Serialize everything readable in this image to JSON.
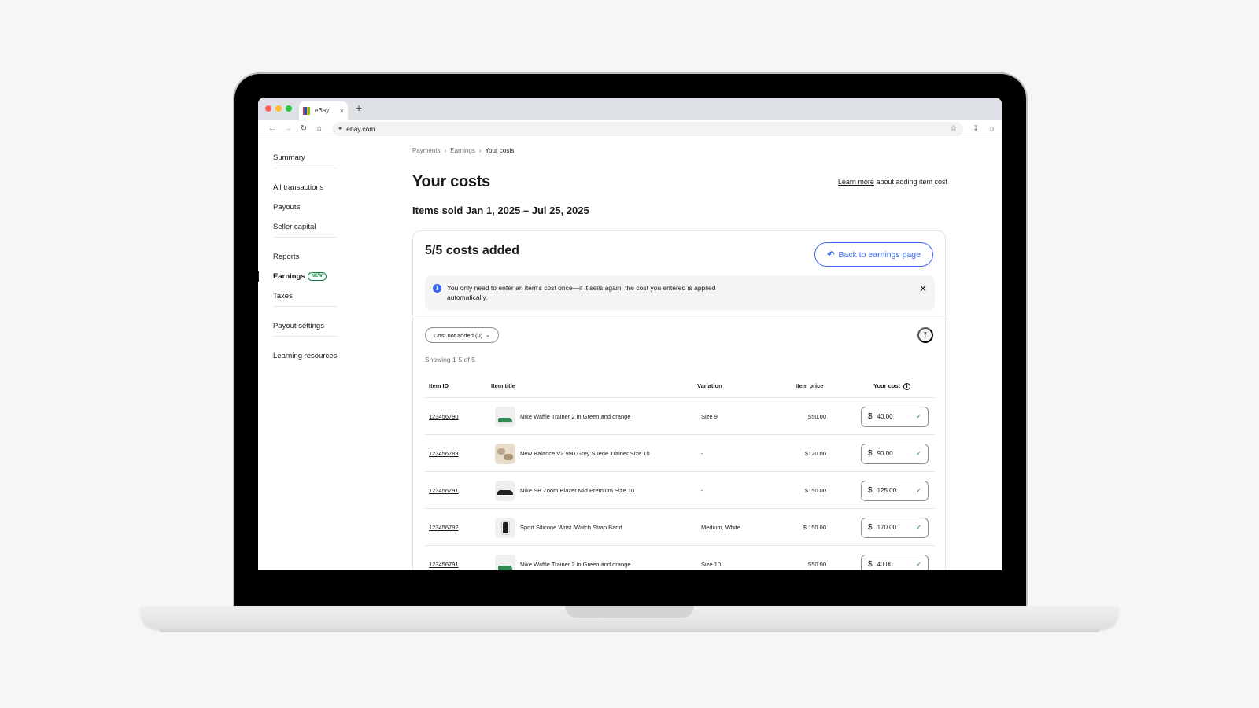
{
  "browser": {
    "tab_title": "eBay",
    "tab_close": "×",
    "new_tab": "+",
    "url": "ebay.com"
  },
  "sidebar": {
    "groups": [
      [
        {
          "label": "Summary"
        }
      ],
      [
        {
          "label": "All transactions"
        },
        {
          "label": "Payouts"
        },
        {
          "label": "Seller capital"
        }
      ],
      [
        {
          "label": "Reports"
        },
        {
          "label": "Earnings",
          "badge": "NEW",
          "active": true
        },
        {
          "label": "Taxes"
        }
      ],
      [
        {
          "label": "Payout settings"
        }
      ],
      [
        {
          "label": "Learning resources"
        }
      ]
    ]
  },
  "breadcrumb": [
    "Payments",
    "Earnings",
    "Your costs"
  ],
  "page": {
    "title": "Your costs",
    "learn_more_link": "Learn more",
    "learn_more_rest": " about adding item cost",
    "date_range": "Items sold Jan 1, 2025 – Jul 25, 2025"
  },
  "card": {
    "title": "5/5 costs added",
    "back_button": "Back to earnings page",
    "info_text": "You only need to enter an item's cost once—if it sells again, the cost you entered is applied automatically.",
    "filter_label": "Cost not added (0)",
    "showing": "Showing 1-5 of 5"
  },
  "table": {
    "headers": {
      "item_id": "Item ID",
      "item_title": "Item title",
      "variation": "Variation",
      "item_price": "Item price",
      "your_cost": "Your cost"
    },
    "currency_symbol": "$",
    "rows": [
      {
        "id": "123456790",
        "title": "Nike Waffle Trainer 2  in Green and orange",
        "variation": "Size 9",
        "price": "$50.00",
        "cost": "40.00"
      },
      {
        "id": "123456789",
        "title": "New Balance V2 990 Grey Suede Trainer Size 10",
        "variation": "-",
        "price": "$120.00",
        "cost": "90.00"
      },
      {
        "id": "123456791",
        "title": "Nike SB Zoom Blazer Mid Premium Size 10",
        "variation": "-",
        "price": "$150.00",
        "cost": "125.00"
      },
      {
        "id": "123456792",
        "title": "Sport Silicone Wrist iWatch Strap Band",
        "variation": "Medium, White",
        "price": "$ 150.00",
        "cost": "170.00"
      },
      {
        "id": "123456791",
        "title": "Nike Waffle Trainer 2  in Green and orange",
        "variation": "Size 10",
        "price": "$50.00",
        "cost": "40.00"
      }
    ]
  },
  "colors": {
    "primary_blue": "#3665f3",
    "success_green": "#118242",
    "text": "#191919",
    "muted": "#707070"
  }
}
